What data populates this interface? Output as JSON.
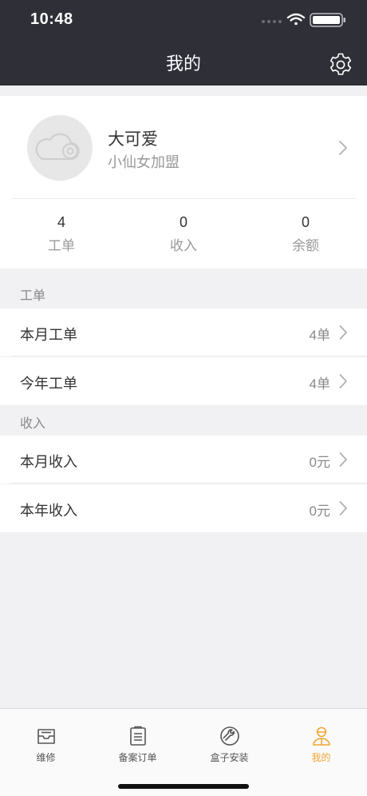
{
  "status_bar": {
    "time": "10:48"
  },
  "header": {
    "title": "我的"
  },
  "profile": {
    "name": "大可爱",
    "subtitle": "小仙女加盟",
    "stats": [
      {
        "value": "4",
        "label": "工单"
      },
      {
        "value": "0",
        "label": "收入"
      },
      {
        "value": "0",
        "label": "余额"
      }
    ]
  },
  "sections": [
    {
      "label": "工单",
      "rows": [
        {
          "title": "本月工单",
          "value": "4单"
        },
        {
          "title": "今年工单",
          "value": "4单"
        }
      ]
    },
    {
      "label": "收入",
      "rows": [
        {
          "title": "本月收入",
          "value": "0元"
        },
        {
          "title": "本年收入",
          "value": "0元"
        }
      ]
    }
  ],
  "tabbar": {
    "items": [
      {
        "label": "维修",
        "icon": "inbox-icon"
      },
      {
        "label": "备案订单",
        "icon": "clipboard-icon"
      },
      {
        "label": "盒子安装",
        "icon": "wrench-icon"
      },
      {
        "label": "我的",
        "icon": "person-icon"
      }
    ],
    "active_index": 3
  },
  "colors": {
    "header_bg": "#2f2f38",
    "accent": "#f0a431",
    "background": "#f1f1f3"
  }
}
